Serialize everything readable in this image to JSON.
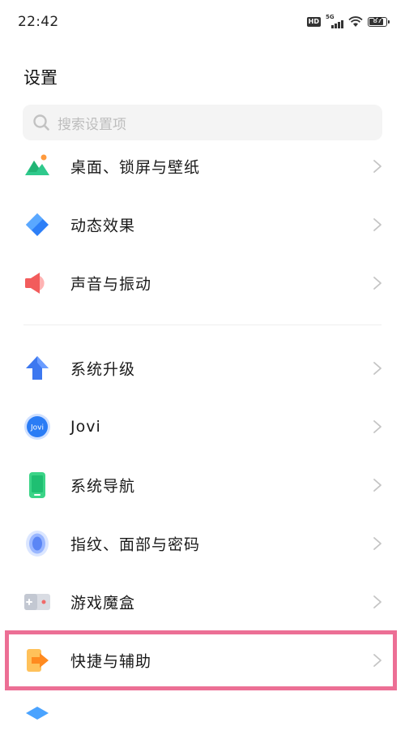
{
  "status_bar": {
    "time": "22:42",
    "hd": "HD",
    "network": "5G",
    "battery": "87",
    "battery_level": 0.87
  },
  "page": {
    "title": "设置"
  },
  "search": {
    "placeholder": "搜索设置项",
    "icon": "search-icon"
  },
  "groups": [
    {
      "items": [
        {
          "label": "桌面、锁屏与壁纸",
          "icon": "wallpaper-icon"
        },
        {
          "label": "动态效果",
          "icon": "dynamic-effects-icon"
        },
        {
          "label": "声音与振动",
          "icon": "sound-icon"
        }
      ]
    },
    {
      "items": [
        {
          "label": "系统升级",
          "icon": "system-update-icon"
        },
        {
          "label": "Jovi",
          "icon": "jovi-icon"
        },
        {
          "label": "系统导航",
          "icon": "system-navigation-icon"
        },
        {
          "label": "指纹、面部与密码",
          "icon": "fingerprint-icon"
        },
        {
          "label": "游戏魔盒",
          "icon": "game-box-icon"
        },
        {
          "label": "快捷与辅助",
          "icon": "shortcuts-icon"
        }
      ]
    }
  ],
  "colors": {
    "highlight": "#ec6f95",
    "search_bg": "#f4f4f4",
    "chevron": "#c4c4c4"
  }
}
